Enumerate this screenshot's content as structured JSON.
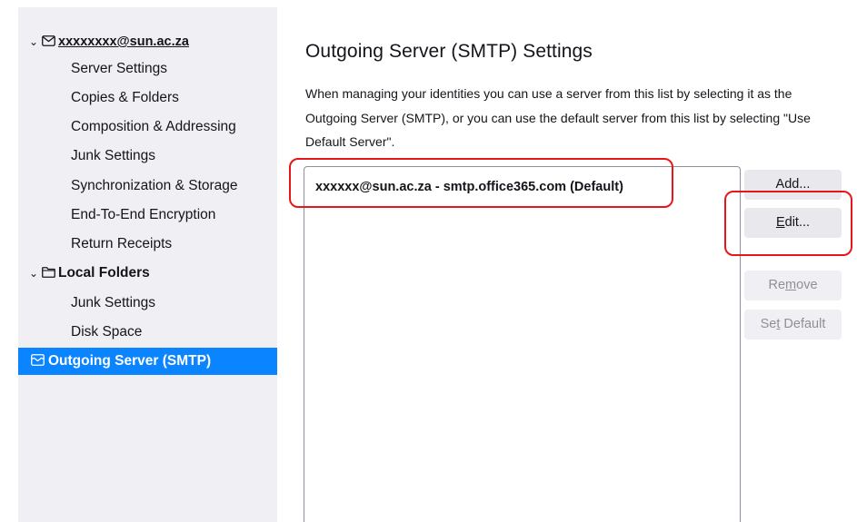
{
  "sidebar": {
    "account": {
      "label": "xxxxxxxx@sun.ac.za"
    },
    "account_items": [
      {
        "label": "Server Settings"
      },
      {
        "label": "Copies & Folders"
      },
      {
        "label": "Composition & Addressing"
      },
      {
        "label": "Junk Settings"
      },
      {
        "label": "Synchronization & Storage"
      },
      {
        "label": "End-To-End Encryption"
      },
      {
        "label": "Return Receipts"
      }
    ],
    "local_folders": {
      "label": "Local Folders"
    },
    "local_items": [
      {
        "label": "Junk Settings"
      },
      {
        "label": "Disk Space"
      }
    ],
    "outgoing": {
      "label": "Outgoing Server (SMTP)"
    }
  },
  "main": {
    "title": "Outgoing Server (SMTP) Settings",
    "description": "When managing your identities you can use a server from this list by selecting it as the Outgoing Server (SMTP), or you can use the default server from this list by selecting \"Use Default Server\".",
    "servers": [
      {
        "label": "xxxxxx@sun.ac.za - smtp.office365.com (Default)"
      }
    ],
    "buttons": {
      "add": {
        "pre": "Add",
        "key": "",
        "post": "..."
      },
      "edit": {
        "pre": "",
        "key": "E",
        "post": "dit..."
      },
      "remove": {
        "pre": "Re",
        "key": "m",
        "post": "ove"
      },
      "set_default": {
        "pre": "Se",
        "key": "t",
        "post": " Default"
      }
    }
  },
  "colors": {
    "selection": "#0a84ff",
    "sidebar_bg": "#f0f0f4",
    "annotation": "#e8161b"
  }
}
